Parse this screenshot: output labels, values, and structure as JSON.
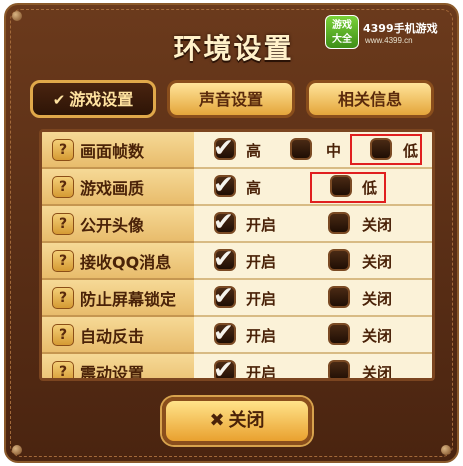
{
  "window": {
    "title": "环境设置"
  },
  "logo": {
    "badge_line1": "游戏",
    "badge_line2": "大全",
    "name": "4399手机游戏",
    "url": "www.4399.cn"
  },
  "tabs": [
    {
      "label": "游戏设置",
      "active": true
    },
    {
      "label": "声音设置",
      "active": false
    },
    {
      "label": "相关信息",
      "active": false
    }
  ],
  "help_icon": "?",
  "settings": [
    {
      "label": "画面帧数",
      "options": [
        {
          "text": "高",
          "checked": true
        },
        {
          "text": "中",
          "checked": false
        },
        {
          "text": "低",
          "checked": false
        }
      ]
    },
    {
      "label": "游戏画质",
      "options": [
        {
          "text": "高",
          "checked": true
        },
        {
          "text": "低",
          "checked": false
        }
      ]
    },
    {
      "label": "公开头像",
      "options": [
        {
          "text": "开启",
          "checked": true
        },
        {
          "text": "关闭",
          "checked": false
        }
      ]
    },
    {
      "label": "接收QQ消息",
      "options": [
        {
          "text": "开启",
          "checked": true
        },
        {
          "text": "关闭",
          "checked": false
        }
      ]
    },
    {
      "label": "防止屏幕锁定",
      "options": [
        {
          "text": "开启",
          "checked": true
        },
        {
          "text": "关闭",
          "checked": false
        }
      ]
    },
    {
      "label": "自动反击",
      "options": [
        {
          "text": "开启",
          "checked": true
        },
        {
          "text": "关闭",
          "checked": false
        }
      ]
    },
    {
      "label": "震动设置",
      "options": [
        {
          "text": "开启",
          "checked": true
        },
        {
          "text": "关闭",
          "checked": false
        }
      ]
    }
  ],
  "close_button": {
    "label": "关闭"
  },
  "colors": {
    "frame": "#4a2410",
    "tab_active_border": "#e0a84a",
    "highlight_box": "#e01f1f"
  }
}
